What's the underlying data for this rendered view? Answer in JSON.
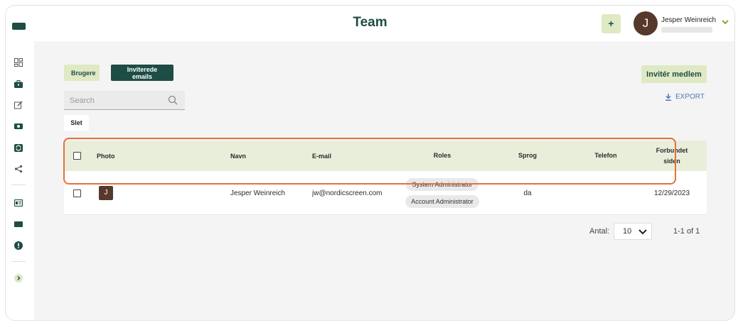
{
  "header": {
    "title": "Team",
    "add_label": "+",
    "user": {
      "initial": "J",
      "name": "Jesper Weinreich"
    }
  },
  "sidebar": {
    "items": [
      "dashboard-icon",
      "briefcase-icon",
      "edit-icon",
      "camera-icon",
      "sync-icon",
      "share-icon",
      "id-card-icon",
      "screen-icon",
      "alert-icon",
      "expand-icon"
    ]
  },
  "tabs": {
    "users": "Brugere",
    "invited": "Inviterede emails"
  },
  "actions": {
    "invite": "Invitér medlem",
    "export": "EXPORT",
    "delete": "Slet"
  },
  "search": {
    "placeholder": "Search"
  },
  "table": {
    "columns": {
      "photo": "Photo",
      "name": "Navn",
      "email": "E-mail",
      "roles": "Roles",
      "language": "Sprog",
      "phone": "Telefon",
      "connected_line1": "Forbundet",
      "connected_line2": "siden"
    },
    "rows": [
      {
        "initial": "J",
        "name": "Jesper Weinreich",
        "email": "jw@nordicscreen.com",
        "roles": [
          "System Administrator",
          "Account Administrator"
        ],
        "language": "da",
        "phone": "",
        "connected": "12/29/2023"
      }
    ]
  },
  "pagination": {
    "label": "Antal:",
    "page_size": "10",
    "range": "1-1 of 1"
  },
  "colors": {
    "brand_dark": "#1e4d45",
    "brand_light": "#dfe9c4",
    "highlight": "#e6703a",
    "avatar": "#57392c"
  }
}
